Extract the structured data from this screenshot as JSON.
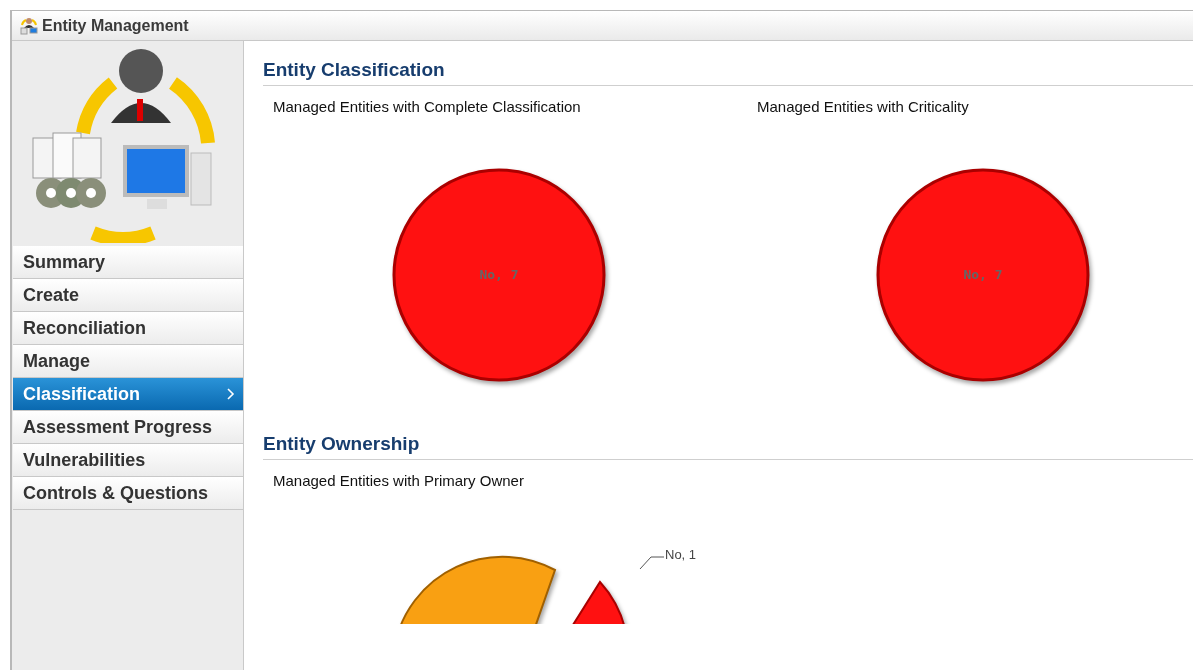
{
  "window": {
    "title": "Entity Management"
  },
  "sidebar": {
    "items": [
      {
        "label": "Summary",
        "selected": false
      },
      {
        "label": "Create",
        "selected": false
      },
      {
        "label": "Reconciliation",
        "selected": false
      },
      {
        "label": "Manage",
        "selected": false
      },
      {
        "label": "Classification",
        "selected": true
      },
      {
        "label": "Assessment Progress",
        "selected": false
      },
      {
        "label": "Vulnerabilities",
        "selected": false
      },
      {
        "label": "Controls & Questions",
        "selected": false
      }
    ]
  },
  "sections": [
    {
      "title": "Entity Classification",
      "charts": [
        {
          "title": "Managed Entities with Complete Classification",
          "kind": "whole",
          "slice_label": "No, 7"
        },
        {
          "title": "Managed Entities with Criticality",
          "kind": "whole",
          "slice_label": "No, 7"
        }
      ]
    },
    {
      "title": "Entity Ownership",
      "charts": [
        {
          "title": "Managed Entities with Primary Owner",
          "kind": "split",
          "slice_label": "No, 1"
        }
      ]
    }
  ]
}
